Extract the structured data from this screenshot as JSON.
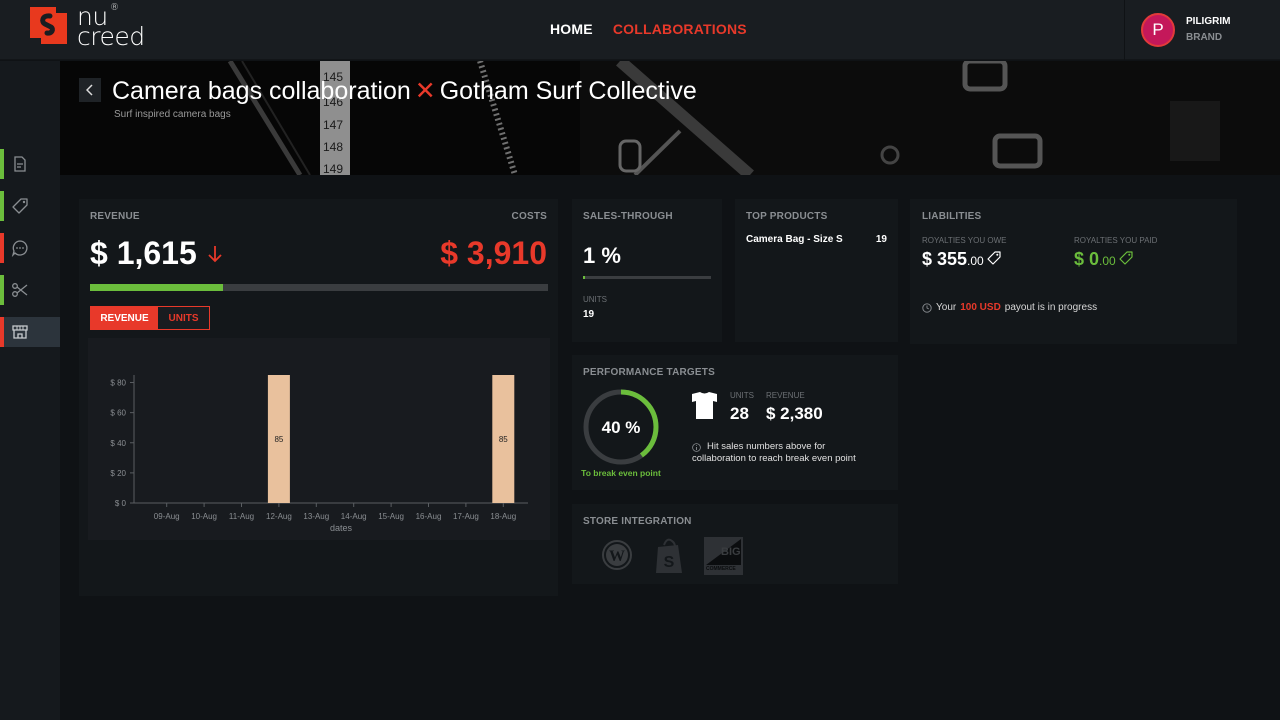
{
  "app": {
    "logo_text_line1": "nu",
    "logo_text_line2": "creed",
    "logo_reg": "®"
  },
  "nav": {
    "items": [
      {
        "label": "HOME",
        "active": false
      },
      {
        "label": "COLLABORATIONS",
        "active": true
      }
    ]
  },
  "user": {
    "initial": "P",
    "name": "PILIGRIM",
    "role": "BRAND"
  },
  "sidebar": {
    "items": [
      {
        "icon": "document-icon",
        "status_color": "#6bbd3c",
        "active": false
      },
      {
        "icon": "tag-icon",
        "status_color": "#6bbd3c",
        "active": false
      },
      {
        "icon": "chat-icon",
        "status_color": "#e8392a",
        "active": false
      },
      {
        "icon": "scissors-icon",
        "status_color": "#6bbd3c",
        "active": false
      },
      {
        "icon": "store-icon",
        "status_color": "#e8392a",
        "active": true
      }
    ]
  },
  "header": {
    "title_left": "Camera bags collaboration",
    "title_separator": "✕",
    "title_right": "Gotham Surf Collective",
    "subtitle": "Surf inspired camera bags"
  },
  "revenue": {
    "label": "REVENUE",
    "value": "$ 1,615",
    "trend": "down",
    "costs_label": "COSTS",
    "costs_value": "$ 3,910",
    "progress_fraction": 0.29,
    "toggle": {
      "revenue_label": "REVENUE",
      "units_label": "UNITS",
      "selected": "REVENUE"
    }
  },
  "sales_through": {
    "label": "SALES-THROUGH",
    "value": "1 %",
    "progress_fraction": 0.01,
    "units_label": "UNITS",
    "units_value": "19"
  },
  "top_products": {
    "label": "TOP PRODUCTS",
    "items": [
      {
        "name": "Camera Bag - Size S",
        "count": "19"
      }
    ]
  },
  "liabilities": {
    "label": "LIABILITIES",
    "owe_label": "ROYALTIES YOU OWE",
    "owe_main": "$ 355",
    "owe_cents": ".00",
    "paid_label": "ROYALTIES YOU PAID",
    "paid_main": "$ 0",
    "paid_cents": ".00",
    "payout_prefix": "Your",
    "payout_amount": "100 USD",
    "payout_suffix": "payout is in progress"
  },
  "performance": {
    "label": "PERFORMANCE TARGETS",
    "percent_label": "40 %",
    "percent_value": 40,
    "caption": "To break even point",
    "units_label": "UNITS",
    "units_value": "28",
    "revenue_label": "REVENUE",
    "revenue_value": "$ 2,380",
    "info_line1": "Hit sales numbers above for",
    "info_line2": "collaboration to reach break even point"
  },
  "store_integration": {
    "label": "STORE INTEGRATION",
    "stores": [
      "wordpress",
      "shopify",
      "bigcommerce"
    ],
    "bigcommerce_text1": "BIG",
    "bigcommerce_text2": "COMMERCE"
  },
  "chart_data": {
    "type": "bar",
    "title": "",
    "xlabel": "dates",
    "ylabel": "",
    "categories": [
      "09-Aug",
      "10-Aug",
      "11-Aug",
      "12-Aug",
      "13-Aug",
      "14-Aug",
      "15-Aug",
      "16-Aug",
      "17-Aug",
      "18-Aug"
    ],
    "values": [
      0,
      0,
      0,
      85,
      0,
      0,
      0,
      0,
      0,
      85
    ],
    "data_labels": [
      "",
      "",
      "",
      "85",
      "",
      "",
      "",
      "",
      "",
      "85"
    ],
    "yticks": [
      0,
      20,
      40,
      60,
      80
    ],
    "ytick_labels": [
      "$ 0",
      "$ 20",
      "$ 40",
      "$ 60",
      "$ 80"
    ],
    "ylim": [
      0,
      85
    ],
    "bar_color": "#e9c19d",
    "grid": false,
    "legend": "none"
  }
}
